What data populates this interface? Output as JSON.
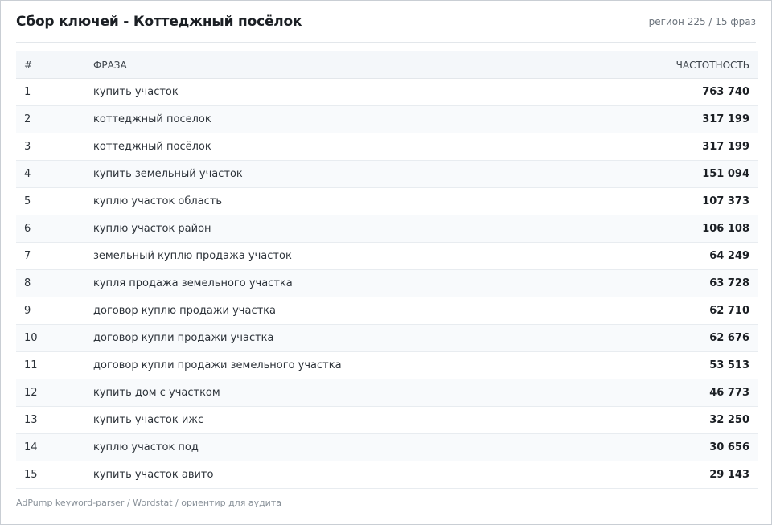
{
  "header": {
    "title": "Сбор ключей - Коттеджный посёлок",
    "meta": "регион 225 / 15 фраз"
  },
  "table": {
    "columns": [
      "#",
      "ФРАЗА",
      "ЧАСТОТНОСТЬ"
    ],
    "rows": [
      {
        "n": "1",
        "phrase": "купить участок",
        "freq": "763 740"
      },
      {
        "n": "2",
        "phrase": "коттеджный поселок",
        "freq": "317 199"
      },
      {
        "n": "3",
        "phrase": "коттеджный посёлок",
        "freq": "317 199"
      },
      {
        "n": "4",
        "phrase": "купить земельный участок",
        "freq": "151 094"
      },
      {
        "n": "5",
        "phrase": "куплю участок область",
        "freq": "107 373"
      },
      {
        "n": "6",
        "phrase": "куплю участок район",
        "freq": "106 108"
      },
      {
        "n": "7",
        "phrase": "земельный куплю продажа участок",
        "freq": "64 249"
      },
      {
        "n": "8",
        "phrase": "купля продажа земельного участка",
        "freq": "63 728"
      },
      {
        "n": "9",
        "phrase": "договор куплю продажи участка",
        "freq": "62 710"
      },
      {
        "n": "10",
        "phrase": "договор купли продажи участка",
        "freq": "62 676"
      },
      {
        "n": "11",
        "phrase": "договор купли продажи земельного участка",
        "freq": "53 513"
      },
      {
        "n": "12",
        "phrase": "купить дом с участком",
        "freq": "46 773"
      },
      {
        "n": "13",
        "phrase": "купить участок ижс",
        "freq": "32 250"
      },
      {
        "n": "14",
        "phrase": "куплю участок под",
        "freq": "30 656"
      },
      {
        "n": "15",
        "phrase": "купить участок авито",
        "freq": "29 143"
      }
    ]
  },
  "footer": {
    "text": "AdPump keyword-parser / Wordstat / ориентир для аудита"
  }
}
